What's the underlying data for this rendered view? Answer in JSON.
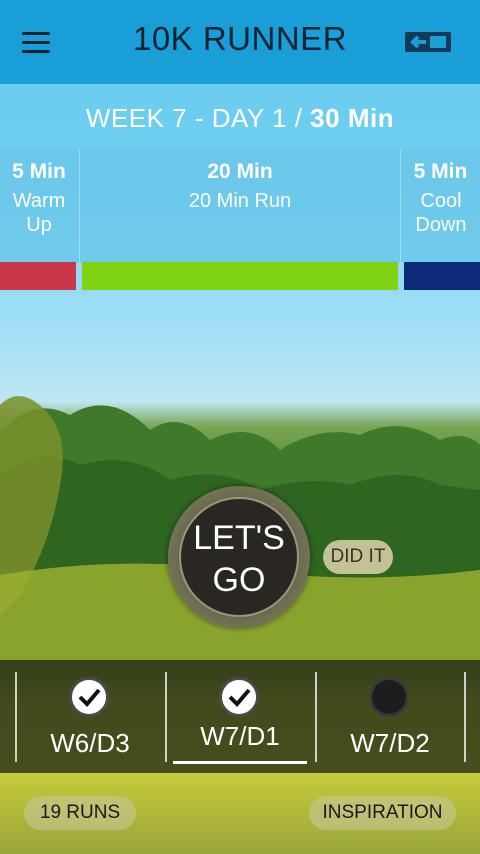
{
  "header": {
    "title": "10K RUNNER",
    "menu_icon": "hamburger-menu-icon",
    "exit_icon": "exit-icon"
  },
  "week": {
    "prefix": "WEEK 7 - DAY 1 / ",
    "duration": "30 Min"
  },
  "segments": [
    {
      "minutes": "5 Min",
      "name": "Warm Up",
      "color": "#c8384a"
    },
    {
      "minutes": "20 Min",
      "name": "20 Min Run",
      "color": "#7fd313"
    },
    {
      "minutes": "5 Min",
      "name": "Cool Down",
      "color": "#0e2a7a"
    }
  ],
  "go_button": {
    "line1": "LET'S",
    "line2": "GO"
  },
  "did_it": "DID IT",
  "days": [
    {
      "label": "W6/D3",
      "completed": true
    },
    {
      "label": "W7/D1",
      "completed": true,
      "selected": true
    },
    {
      "label": "W7/D2",
      "completed": false
    }
  ],
  "runs_label": "19 RUNS",
  "inspiration_label": "INSPIRATION",
  "colors": {
    "header": "#1a9ed8",
    "week_bar": "#6dcdf0"
  }
}
